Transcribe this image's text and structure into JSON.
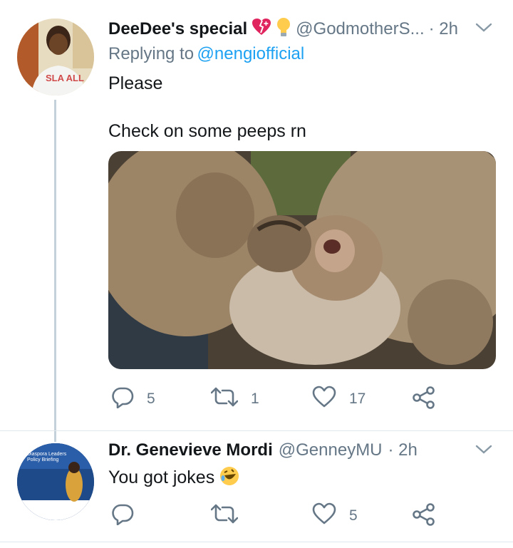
{
  "tweet1": {
    "name": "DeeDee's special",
    "handle": "@GodmotherS...",
    "time": "· 2h",
    "replying_prefix": "Replying to",
    "replying_to": "@nengiofficial",
    "line1": "Please",
    "line2": "Check on some peeps rn",
    "avatar_text": "SLA ALL",
    "stats": {
      "replies": "5",
      "retweets": "1",
      "likes": "17"
    }
  },
  "tweet2": {
    "name": "Dr. Genevieve Mordi",
    "handle": "@GenneyMU",
    "time": "· 2h",
    "text": "You got jokes",
    "avatar_caption": "Diaspora Leaders Policy Briefing",
    "stats": {
      "likes": "5"
    }
  },
  "icons": [
    "heart-emoji-icon",
    "lightbulb-emoji-icon",
    "chevron-down-icon",
    "reply-icon",
    "retweet-icon",
    "like-icon",
    "share-icon",
    "laughing-emoji-icon"
  ],
  "colors": {
    "link": "#1da1f2",
    "muted": "#657786",
    "thread_line": "#c4d0da"
  }
}
